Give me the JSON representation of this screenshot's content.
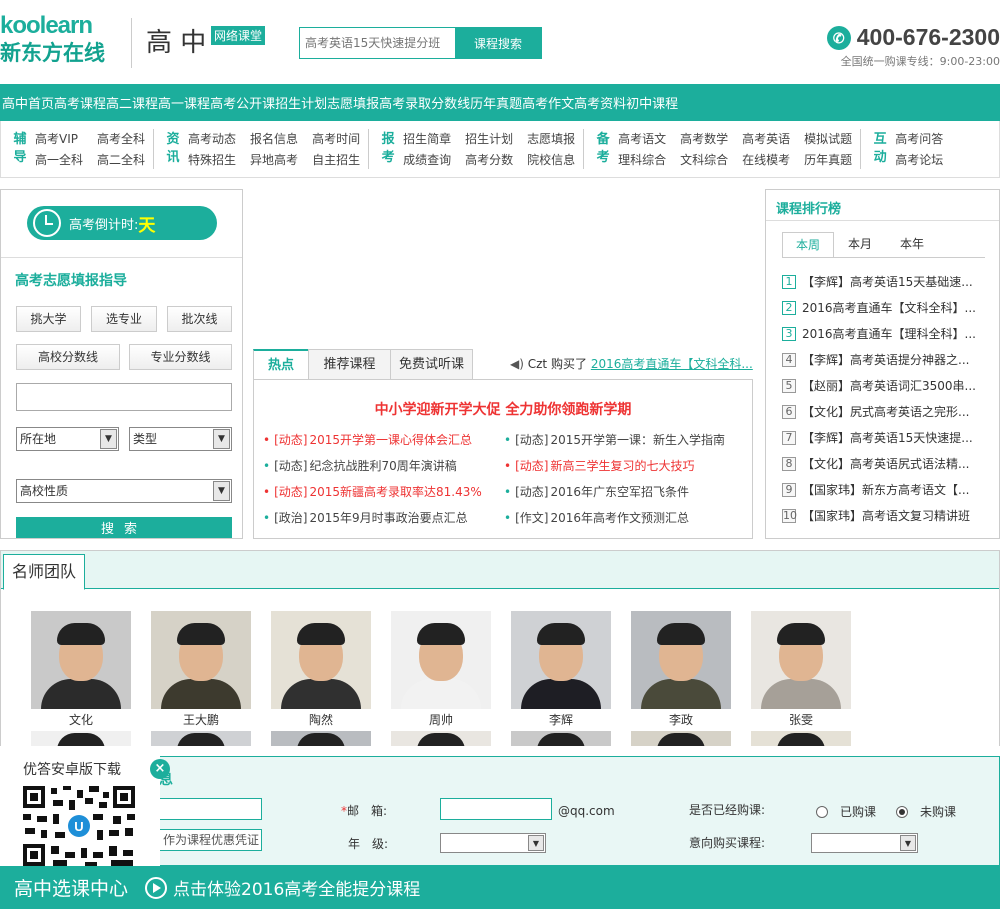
{
  "header": {
    "logo_en": "koolearn",
    "logo_cn": "新东方在线",
    "site_title": "高 中",
    "site_badge": "网络课堂",
    "search_placeholder": "高考英语15天快速提分班",
    "search_button": "课程搜索",
    "hotline": "400-676-2300",
    "hotline_sub": "全国统一购课专线：9:00-23:00"
  },
  "nav": [
    "高中首页",
    "高考课程",
    "高二课程",
    "高一课程",
    "高考公开课",
    "招生计划",
    "志愿填报",
    "高考录取分数线",
    "历年真题",
    "高考作文",
    "高考资料",
    "初中课程"
  ],
  "subnav": [
    {
      "cat": "辅导",
      "links": [
        "高考VIP",
        "高考全科",
        "高一全科",
        "高二全科"
      ]
    },
    {
      "cat": "资讯",
      "links": [
        "高考动态",
        "报名信息",
        "高考时间",
        "特殊招生",
        "异地高考",
        "自主招生"
      ]
    },
    {
      "cat": "报考",
      "links": [
        "招生简章",
        "招生计划",
        "志愿填报",
        "成绩查询",
        "高考分数",
        "院校信息"
      ]
    },
    {
      "cat": "备考",
      "links": [
        "高考语文",
        "高考数学",
        "高考英语",
        "模拟试题",
        "理科综合",
        "文科综合",
        "在线模考",
        "历年真题"
      ]
    },
    {
      "cat": "互动",
      "links": [
        "高考问答",
        "高考论坛"
      ]
    }
  ],
  "left": {
    "countdown": "高考倒计时:",
    "countdown_day": "天",
    "guide_title": "高考志愿填报指导",
    "buttons": [
      "挑大学",
      "选专业",
      "批次线",
      "高校分数线",
      "专业分数线"
    ],
    "select_location": "所在地",
    "select_type": "类型",
    "select_nature": "高校性质",
    "search": "搜索"
  },
  "tabs": [
    "热点",
    "推荐课程",
    "免费试听课"
  ],
  "ticker": {
    "icon": "speaker-icon",
    "user": "Czt",
    "verb": "购买了",
    "course": "2016高考直通车【文科全科..."
  },
  "news": {
    "headline": "中小学迎新开学大促 全力助你领跑新学期",
    "items": [
      {
        "tag": "[动态]",
        "text": "2015开学第一课心得体会汇总",
        "red": true
      },
      {
        "tag": "[动态]",
        "text": "2015开学第一课：新生入学指南",
        "red": false
      },
      {
        "tag": "[动态]",
        "text": "纪念抗战胜利70周年演讲稿",
        "red": false
      },
      {
        "tag": "[动态]",
        "text": "新高三学生复习的七大技巧",
        "red": true
      },
      {
        "tag": "[动态]",
        "text": "2015新疆高考录取率达81.43%",
        "red": true
      },
      {
        "tag": "[动态]",
        "text": "2016年广东空军招飞条件",
        "red": false
      },
      {
        "tag": "[政治]",
        "text": "2015年9月时事政治要点汇总",
        "red": false
      },
      {
        "tag": "[作文]",
        "text": "2016年高考作文预测汇总",
        "red": false
      }
    ]
  },
  "ranking": {
    "title": "课程排行榜",
    "tabs": [
      "本周",
      "本月",
      "本年"
    ],
    "items": [
      "【李辉】高考英语15天基础速...",
      "2016高考直通车【文科全科】...",
      "2016高考直通车【理科全科】...",
      "【李辉】高考英语提分神器之...",
      "【赵丽】高考英语词汇3500串...",
      "【文化】尻式高考英语之完形...",
      "【李辉】高考英语15天快速提...",
      "【文化】高考英语尻式语法精...",
      "【国家玮】新东方高考语文【...",
      "【国家玮】高考语文复习精讲班"
    ],
    "numbers": [
      "1",
      "2",
      "3",
      "4",
      "5",
      "6",
      "7",
      "8",
      "9",
      "10"
    ]
  },
  "team": {
    "title": "名师团队",
    "teachers": [
      "文化",
      "王大鹏",
      "陶然",
      "周帅",
      "李辉",
      "李政",
      "张雯"
    ]
  },
  "form": {
    "title": "息",
    "coupon_text": "作为课程优惠凭证",
    "email_label": "邮　箱:",
    "email_suffix": "@qq.com",
    "grade_label": "年　级:",
    "purchased_label": "是否已经购课:",
    "opt_yes": "已购课",
    "opt_no": "未购课",
    "intent_label": "意向购买课程:"
  },
  "app": {
    "title": "优答安卓版下载",
    "close": "×"
  },
  "bottom": {
    "left": "高中选课中心",
    "right": "点击体验2016高考全能提分课程"
  },
  "colors": {
    "accent": "#1cae9c",
    "red": "#e33333"
  }
}
